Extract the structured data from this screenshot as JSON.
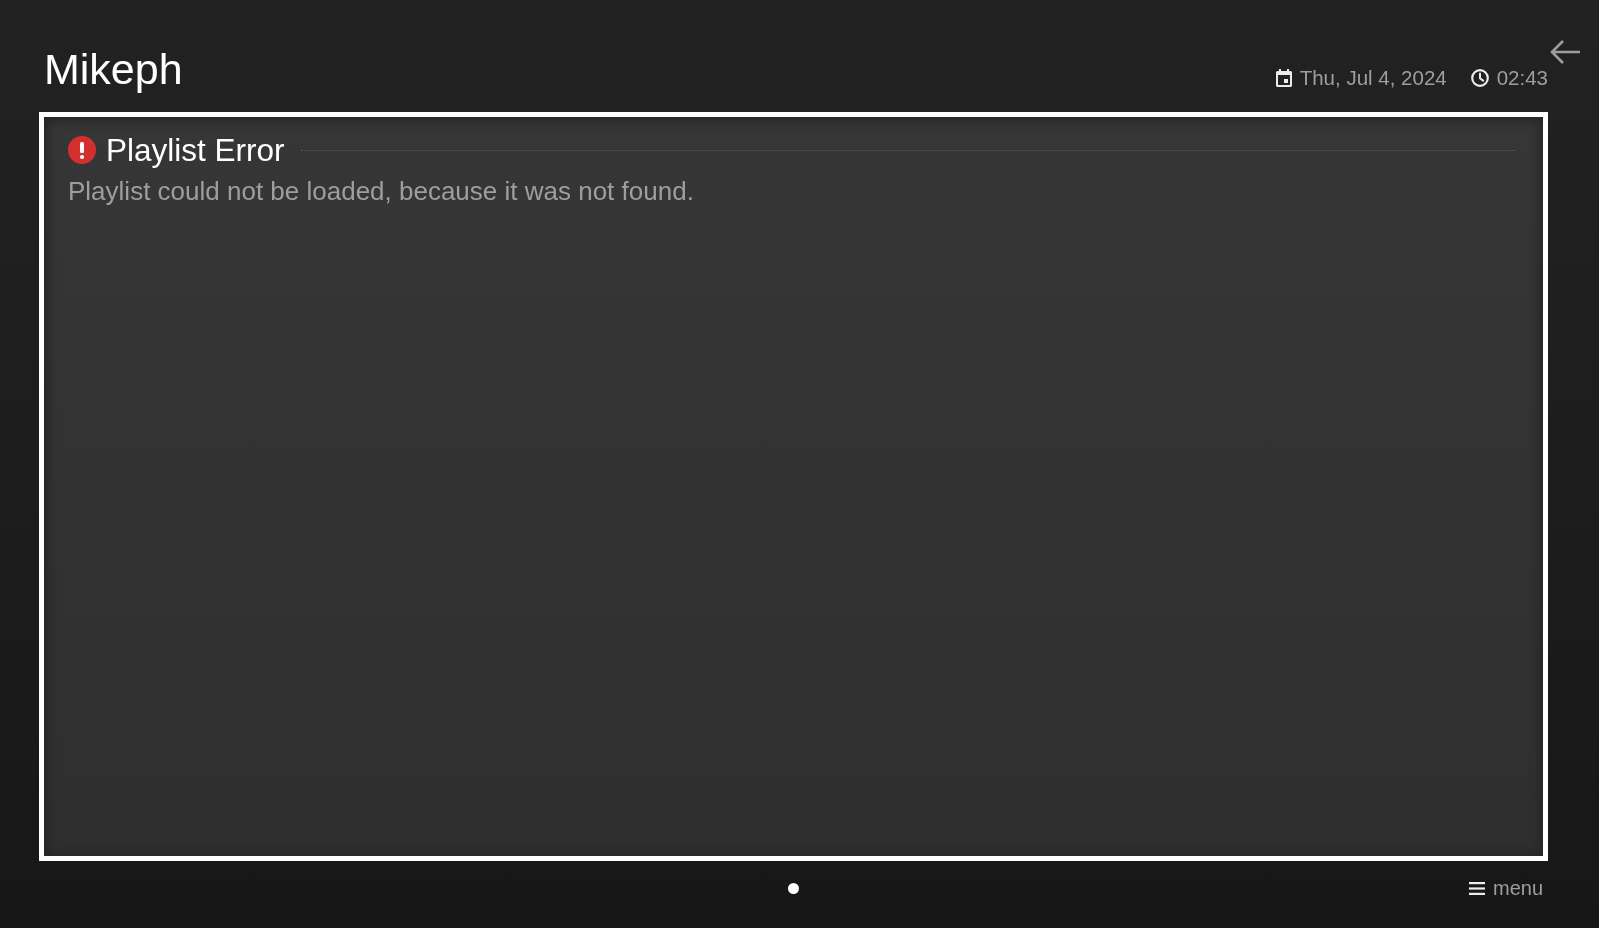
{
  "header": {
    "title": "Mikeph",
    "date": "Thu, Jul 4, 2024",
    "time": "02:43"
  },
  "panel": {
    "focused": true,
    "heading": "Playlist Error",
    "message": "Playlist could not be loaded, because it was not found."
  },
  "pager": {
    "dots": [
      {
        "selected": true
      }
    ]
  },
  "footer": {
    "menu_label": "menu"
  }
}
